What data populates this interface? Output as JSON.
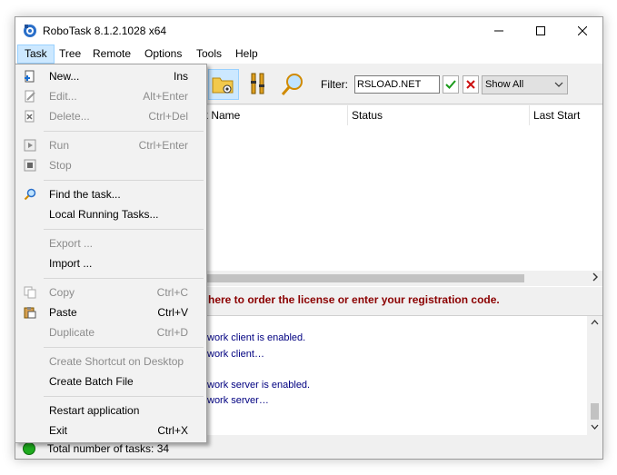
{
  "window": {
    "title": "RoboTask 8.1.2.1028 x64"
  },
  "menubar": {
    "items": [
      {
        "label": "Task"
      },
      {
        "label": "Tree"
      },
      {
        "label": "Remote"
      },
      {
        "label": "Options"
      },
      {
        "label": "Tools"
      },
      {
        "label": "Help"
      }
    ]
  },
  "toolbar": {
    "filter_label": "Filter:",
    "filter_value": "RSLOAD.NET",
    "show_value": "Show All"
  },
  "columns": [
    "Task Name",
    "Status",
    "Last Start"
  ],
  "columns_visible": [
    "sk Name",
    "Status",
    "Last Start"
  ],
  "license_text": "here to order the license or enter your registration code.",
  "log_lines": [
    "work client is enabled.",
    "work client…",
    "work server is enabled.",
    "work server…"
  ],
  "status": {
    "text": "Total number of tasks: 34",
    "color": "#1faa1f"
  },
  "task_menu": {
    "items": [
      {
        "label": "New...",
        "shortcut": "Ins",
        "disabled": false,
        "icon": "new-task-icon"
      },
      {
        "label": "Edit...",
        "shortcut": "Alt+Enter",
        "disabled": true,
        "icon": "edit-icon"
      },
      {
        "label": "Delete...",
        "shortcut": "Ctrl+Del",
        "disabled": true,
        "icon": "delete-icon"
      },
      {
        "label": "Run",
        "shortcut": "Ctrl+Enter",
        "disabled": true,
        "icon": "run-icon"
      },
      {
        "label": "Stop",
        "shortcut": "",
        "disabled": true,
        "icon": "stop-icon"
      },
      {
        "label": "Find the task...",
        "shortcut": "",
        "disabled": false,
        "icon": "find-icon"
      },
      {
        "label": "Local Running Tasks...",
        "shortcut": "",
        "disabled": false,
        "icon": ""
      },
      {
        "label": "Export ...",
        "shortcut": "",
        "disabled": true,
        "icon": ""
      },
      {
        "label": "Import ...",
        "shortcut": "",
        "disabled": false,
        "icon": ""
      },
      {
        "label": "Copy",
        "shortcut": "Ctrl+C",
        "disabled": true,
        "icon": "copy-icon"
      },
      {
        "label": "Paste",
        "shortcut": "Ctrl+V",
        "disabled": false,
        "icon": "paste-icon"
      },
      {
        "label": "Duplicate",
        "shortcut": "Ctrl+D",
        "disabled": true,
        "icon": ""
      },
      {
        "label": "Create Shortcut on Desktop",
        "shortcut": "",
        "disabled": true,
        "icon": ""
      },
      {
        "label": "Create Batch File",
        "shortcut": "",
        "disabled": false,
        "icon": ""
      },
      {
        "label": "Restart application",
        "shortcut": "",
        "disabled": false,
        "icon": ""
      },
      {
        "label": "Exit",
        "shortcut": "Ctrl+X",
        "disabled": false,
        "icon": ""
      }
    ]
  }
}
